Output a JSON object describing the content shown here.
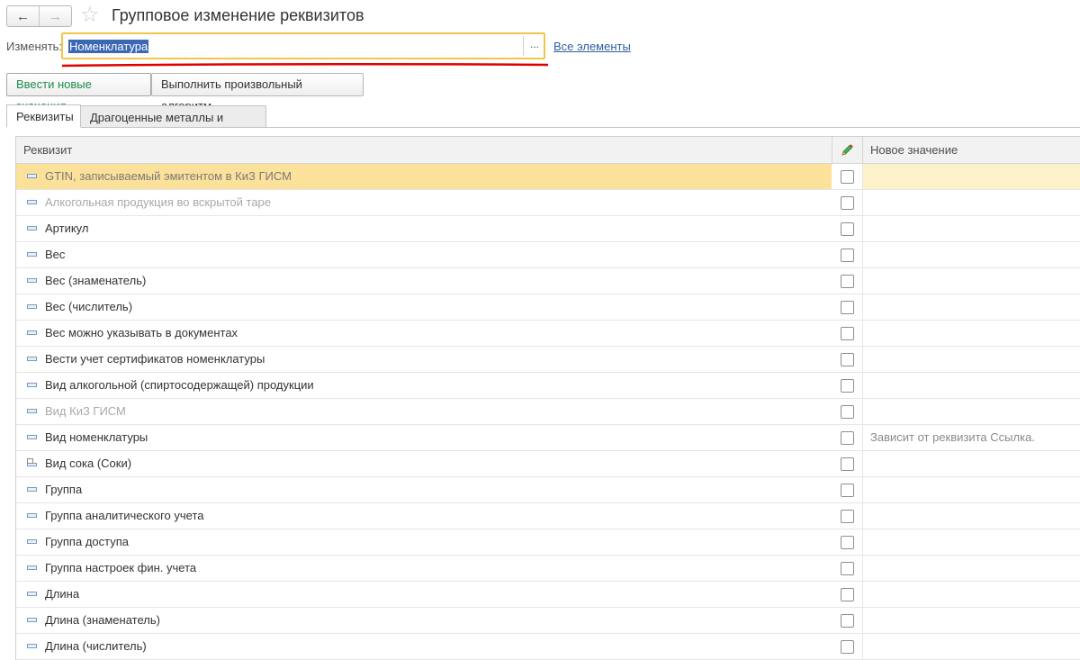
{
  "window": {
    "title": "Групповое изменение реквизитов",
    "back_icon": "arrow-left-icon",
    "forward_icon": "arrow-right-icon",
    "favorite_icon": "star-icon"
  },
  "change": {
    "label": "Изменять:",
    "value": "Номенклатура",
    "choose_label": "...",
    "all_items_link": "Все элементы"
  },
  "toolbar": {
    "new_values_label": "Ввести новые значения",
    "algorithm_label": "Выполнить произвольный алгоритм"
  },
  "tabs": [
    {
      "label": "Реквизиты",
      "active": true
    },
    {
      "label": "Драгоценные металлы и камни",
      "active": false
    }
  ],
  "table": {
    "columns": {
      "name": "Реквизит",
      "edit_icon": "pencil-icon",
      "new_value": "Новое значение"
    },
    "rows": [
      {
        "name": "GTIN, записываемый эмитентом в КиЗ ГИСМ",
        "checked": false,
        "value": "",
        "style": "selected"
      },
      {
        "name": "Алкогольная продукция во вскрытой таре",
        "checked": false,
        "value": "",
        "style": "dim"
      },
      {
        "name": "Артикул",
        "checked": false,
        "value": "",
        "style": "normal"
      },
      {
        "name": "Вес",
        "checked": false,
        "value": "",
        "style": "normal"
      },
      {
        "name": "Вес (знаменатель)",
        "checked": false,
        "value": "",
        "style": "normal"
      },
      {
        "name": "Вес (числитель)",
        "checked": false,
        "value": "",
        "style": "normal"
      },
      {
        "name": "Вес можно указывать в документах",
        "checked": false,
        "value": "",
        "style": "normal"
      },
      {
        "name": "Вести учет сертификатов номенклатуры",
        "checked": false,
        "value": "",
        "style": "normal"
      },
      {
        "name": "Вид алкогольной (спиртосодержащей) продукции",
        "checked": false,
        "value": "",
        "style": "normal"
      },
      {
        "name": "Вид КиЗ ГИСМ",
        "checked": false,
        "value": "",
        "style": "dim"
      },
      {
        "name": "Вид номенклатуры",
        "checked": false,
        "value": "Зависит от реквизита Ссылка.",
        "style": "normal"
      },
      {
        "name": "Вид сока (Соки)",
        "checked": false,
        "value": "",
        "style": "normal",
        "icon": "multi"
      },
      {
        "name": "Группа",
        "checked": false,
        "value": "",
        "style": "normal"
      },
      {
        "name": "Группа аналитического учета",
        "checked": false,
        "value": "",
        "style": "normal"
      },
      {
        "name": "Группа доступа",
        "checked": false,
        "value": "",
        "style": "normal"
      },
      {
        "name": "Группа настроек фин. учета",
        "checked": false,
        "value": "",
        "style": "normal"
      },
      {
        "name": "Длина",
        "checked": false,
        "value": "",
        "style": "normal"
      },
      {
        "name": "Длина (знаменатель)",
        "checked": false,
        "value": "",
        "style": "normal"
      },
      {
        "name": "Длина (числитель)",
        "checked": false,
        "value": "",
        "style": "normal"
      }
    ]
  },
  "colors": {
    "selection": "#fbe19a",
    "input_border": "#f0c64d",
    "underline": "#e00000",
    "link": "#2e5e9e",
    "primary_button_text": "#1c8e4a"
  }
}
